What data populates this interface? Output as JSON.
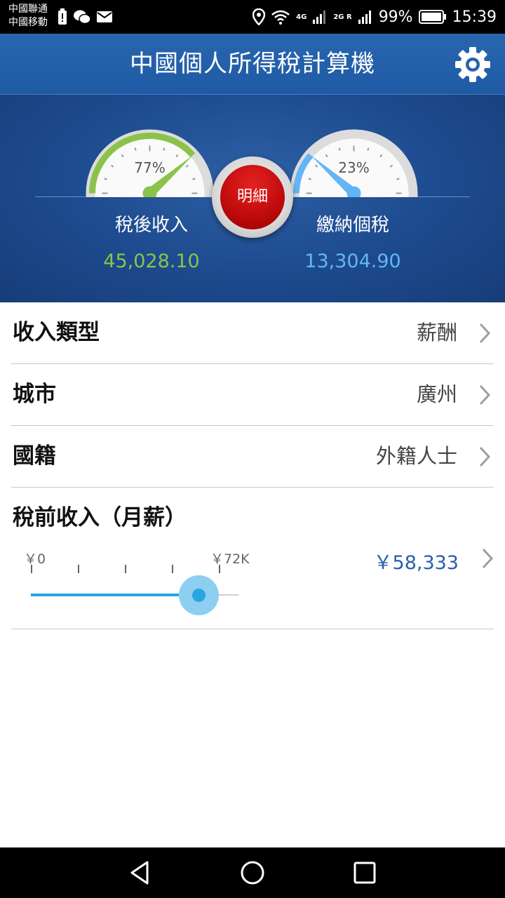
{
  "status_bar": {
    "carrier_1": "中國聯通",
    "carrier_2": "中國移動",
    "network_4g": "4G",
    "network_2g": "2G R",
    "battery": "99%",
    "time": "15:39"
  },
  "header": {
    "title": "中國個人所得稅計算機",
    "settings_icon": "gear-icon"
  },
  "summary": {
    "after_tax": {
      "label": "稅後收入",
      "value": "45,028.10",
      "percent_label": "77%",
      "percent": 77,
      "color": "#8bc34a"
    },
    "tax": {
      "label": "繳納個稅",
      "value": "13,304.90",
      "percent_label": "23%",
      "percent": 23,
      "color": "#64b5f6"
    },
    "detail_button": "明細"
  },
  "settings_rows": [
    {
      "label": "收入類型",
      "value": "薪酬"
    },
    {
      "label": "城市",
      "value": "廣州"
    },
    {
      "label": "國籍",
      "value": "外籍人士"
    }
  ],
  "income": {
    "label": "稅前收入（月薪）",
    "slider_min_label": "￥0",
    "slider_max_label": "￥72K",
    "slider_fraction": 0.81,
    "value": "￥58,333",
    "accent": "#2aa5e0"
  },
  "nav": {
    "back_icon": "back-triangle-icon",
    "home_icon": "home-circle-icon",
    "recents_icon": "recents-square-icon"
  }
}
